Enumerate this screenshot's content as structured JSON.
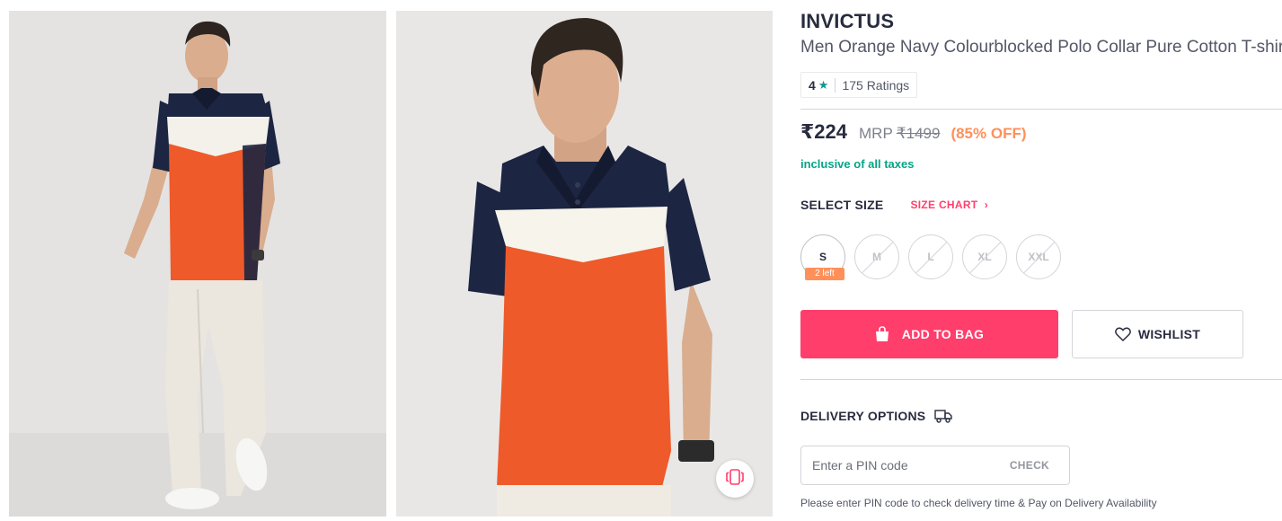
{
  "product": {
    "brand": "INVICTUS",
    "title": "Men Orange Navy Colourblocked Polo Collar Pure Cotton T-shirt",
    "rating": {
      "value": "4",
      "star_icon": "star-icon",
      "count_label": "175 Ratings"
    },
    "price": {
      "current": "₹224",
      "mrp_label": "MRP",
      "mrp": "₹1499",
      "discount": "(85% OFF)"
    },
    "tax_note": "inclusive of all taxes"
  },
  "sizes": {
    "heading": "SELECT SIZE",
    "chart_label": "SIZE CHART",
    "chart_icon": "chevron-right-icon",
    "options": [
      {
        "label": "S",
        "available": true,
        "stock_note": "2 left"
      },
      {
        "label": "M",
        "available": false
      },
      {
        "label": "L",
        "available": false
      },
      {
        "label": "XL",
        "available": false
      },
      {
        "label": "XXL",
        "available": false
      }
    ]
  },
  "actions": {
    "add_to_bag": "ADD TO BAG",
    "add_to_bag_icon": "bag-icon",
    "wishlist": "WISHLIST",
    "wishlist_icon": "heart-icon",
    "similar_icon": "view-similar-icon"
  },
  "delivery": {
    "heading": "DELIVERY OPTIONS",
    "icon": "truck-icon",
    "pin_placeholder": "Enter a PIN code",
    "check_label": "CHECK",
    "note": "Please enter PIN code to check delivery time & Pay on Delivery Availability"
  },
  "colors": {
    "accent": "#ff3e6c",
    "discount": "#ff905a",
    "tax": "#03a685",
    "rating_star": "#14958f",
    "shirt_orange": "#ee5a2a",
    "shirt_navy": "#1c2541"
  }
}
